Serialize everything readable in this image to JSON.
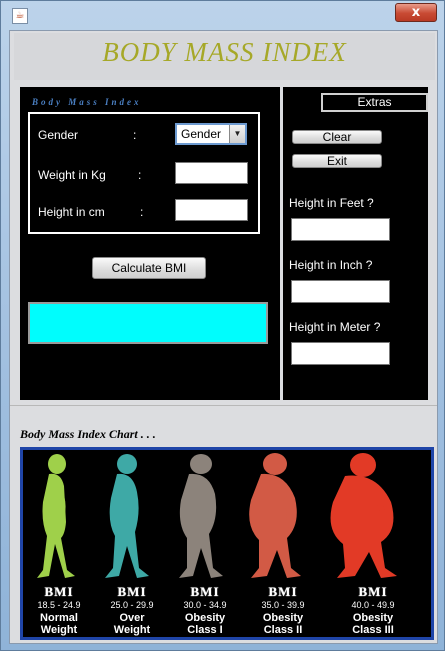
{
  "titlebar": {
    "java_icon": "java-icon",
    "close_label": "x"
  },
  "app": {
    "title": "BODY MASS INDEX"
  },
  "form": {
    "caption": "Body Mass Index",
    "gender_label": "Gender",
    "weight_label": "Weight in Kg",
    "height_label": "Height in cm",
    "colon": ":",
    "gender_selected": "Gender",
    "weight_value": "",
    "height_value": "",
    "calculate_label": "Calculate BMI",
    "result_value": ""
  },
  "extras": {
    "extras_label": "Extras",
    "clear_label": "Clear",
    "exit_label": "Exit",
    "feet_label": "Height in Feet  ?",
    "inch_label": "Height in Inch  ?",
    "meter_label": "Height in Meter  ?",
    "feet_value": "",
    "inch_value": "",
    "meter_value": ""
  },
  "chart": {
    "title": "Body Mass Index Chart . . .",
    "categories": [
      {
        "bmi": "BMI",
        "range": "18.5 - 24.9",
        "line1": "Normal",
        "line2": "Weight",
        "color": "#9fd04a"
      },
      {
        "bmi": "BMI",
        "range": "25.0 - 29.9",
        "line1": "Over",
        "line2": "Weight",
        "color": "#3ea9a6"
      },
      {
        "bmi": "BMI",
        "range": "30.0 - 34.9",
        "line1": "Obesity",
        "line2": "Class I",
        "color": "#8c837b"
      },
      {
        "bmi": "BMI",
        "range": "35.0 - 39.9",
        "line1": "Obesity",
        "line2": "Class II",
        "color": "#d25a45"
      },
      {
        "bmi": "BMI",
        "range": "40.0 - 49.9",
        "line1": "Obesity",
        "line2": "Class III",
        "color": "#e23a26"
      }
    ]
  },
  "colors": {
    "title_olive": "#a6a828",
    "result_cyan": "#00fdfd",
    "chart_border": "#1f45a8",
    "caption_blue": "#4a7fc2"
  }
}
